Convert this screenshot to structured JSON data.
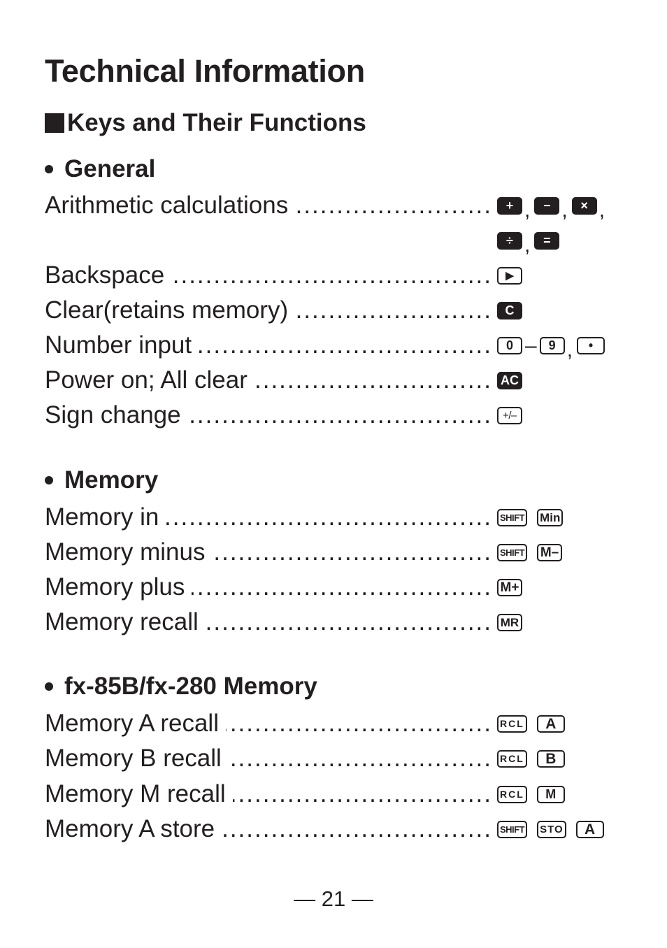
{
  "page": {
    "title": "Technical Information",
    "section_title": "Keys and Their Functions",
    "page_number": "— 21 —"
  },
  "leader": "................................................................................",
  "groups": [
    {
      "heading": "General",
      "rows": [
        {
          "label": "Arithmetic calculations",
          "keys": [
            "+",
            "−",
            "×",
            "÷",
            "="
          ]
        },
        {
          "label": "Backspace",
          "keys": [
            "▶"
          ]
        },
        {
          "label": "Clear(retains memory)",
          "keys": [
            "C"
          ]
        },
        {
          "label": "Number input",
          "keys": [
            "0",
            "9",
            "•"
          ],
          "range_separator": "–"
        },
        {
          "label": "Power on; All clear",
          "keys": [
            "AC"
          ]
        },
        {
          "label": "Sign change",
          "keys": [
            "+/–"
          ]
        }
      ]
    },
    {
      "heading": "Memory",
      "rows": [
        {
          "label": "Memory in",
          "keys": [
            "SHIFT",
            "Min"
          ]
        },
        {
          "label": "Memory minus",
          "keys": [
            "SHIFT",
            "M–"
          ]
        },
        {
          "label": "Memory plus",
          "keys": [
            "M+"
          ]
        },
        {
          "label": "Memory recall",
          "keys": [
            "MR"
          ]
        }
      ]
    },
    {
      "heading": "fx-85B/fx-280 Memory",
      "rows": [
        {
          "label": "Memory A recall",
          "keys": [
            "RCL",
            "A"
          ]
        },
        {
          "label": "Memory B recall",
          "keys": [
            "RCL",
            "B"
          ]
        },
        {
          "label": "Memory M recall",
          "keys": [
            "RCL",
            "M"
          ]
        },
        {
          "label": "Memory A store",
          "keys": [
            "SHIFT",
            "STO",
            "A"
          ]
        }
      ]
    }
  ],
  "punctuation": {
    "comma": ","
  }
}
